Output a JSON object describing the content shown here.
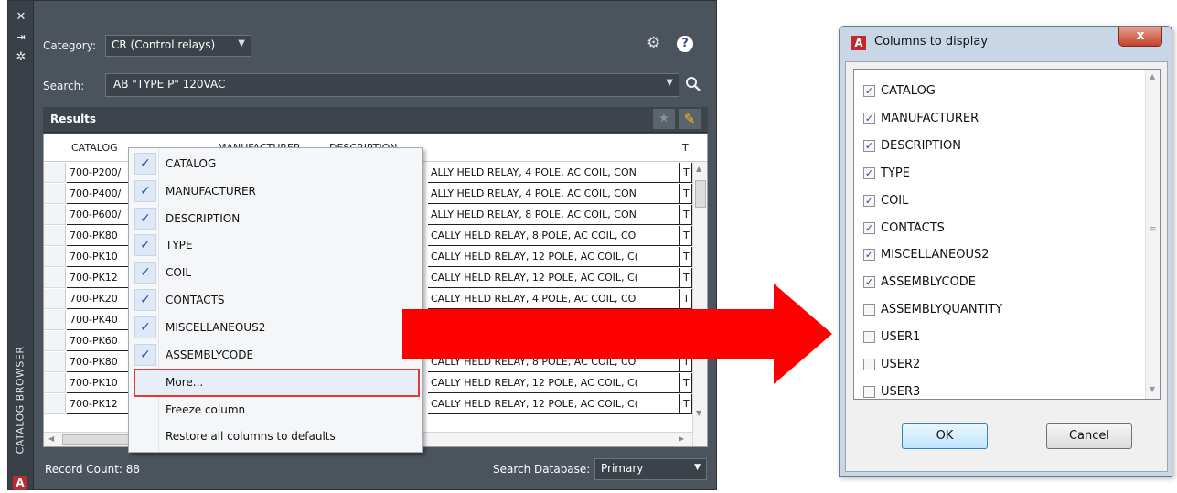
{
  "catalog_browser": {
    "side_title": "CATALOG BROWSER",
    "category_label": "Category:",
    "category_value": "CR (Control relays)",
    "search_label": "Search:",
    "search_value": "AB \"TYPE P\" 120VAC",
    "results_title": "Results",
    "columns": [
      "CATALOG",
      "MANUFACTURER",
      "DESCRIPTION",
      "T"
    ],
    "rows": [
      {
        "catalog": "700-P200/",
        "description": "ALLY HELD RELAY, 4 POLE, AC COIL, CON",
        "type": "T"
      },
      {
        "catalog": "700-P400/",
        "description": "ALLY HELD RELAY, 4 POLE, AC COIL, CON",
        "type": "T"
      },
      {
        "catalog": "700-P600/",
        "description": "ALLY HELD RELAY, 8 POLE, AC COIL, CON",
        "type": "T"
      },
      {
        "catalog": "700-PK80",
        "description": "CALLY HELD RELAY, 8 POLE, AC COIL, CO",
        "type": "T"
      },
      {
        "catalog": "700-PK10",
        "description": "CALLY HELD RELAY, 12 POLE, AC COIL, C(",
        "type": "T"
      },
      {
        "catalog": "700-PK12",
        "description": "CALLY HELD RELAY, 12 POLE, AC COIL, C(",
        "type": "T"
      },
      {
        "catalog": "700-PK20",
        "description": "CALLY HELD RELAY, 4 POLE, AC COIL, CO",
        "type": "T"
      },
      {
        "catalog": "700-PK40",
        "description": "",
        "type": ""
      },
      {
        "catalog": "700-PK60",
        "description": "",
        "type": ""
      },
      {
        "catalog": "700-PK80",
        "description": "CALLY HELD RELAY, 8 POLE, AC COIL, CO",
        "type": "T"
      },
      {
        "catalog": "700-PK10",
        "description": "CALLY HELD RELAY, 12 POLE, AC COIL, C(",
        "type": "T"
      },
      {
        "catalog": "700-PK12",
        "description": "CALLY HELD RELAY, 12 POLE, AC COIL, C(",
        "type": "T"
      }
    ],
    "record_count": "Record Count: 88",
    "search_db_label": "Search Database:",
    "search_db_value": "Primary"
  },
  "context_menu": {
    "checked_items": [
      "CATALOG",
      "MANUFACTURER",
      "DESCRIPTION",
      "TYPE",
      "COIL",
      "CONTACTS",
      "MISCELLANEOUS2",
      "ASSEMBLYCODE"
    ],
    "more": "More...",
    "freeze": "Freeze column",
    "restore": "Restore all columns to defaults"
  },
  "dialog": {
    "title": "Columns to display",
    "close_glyph": "x",
    "items": [
      {
        "label": "CATALOG",
        "checked": true
      },
      {
        "label": "MANUFACTURER",
        "checked": true
      },
      {
        "label": "DESCRIPTION",
        "checked": true
      },
      {
        "label": "TYPE",
        "checked": true
      },
      {
        "label": "COIL",
        "checked": true
      },
      {
        "label": "CONTACTS",
        "checked": true
      },
      {
        "label": "MISCELLANEOUS2",
        "checked": true
      },
      {
        "label": "ASSEMBLYCODE",
        "checked": true
      },
      {
        "label": "ASSEMBLYQUANTITY",
        "checked": false
      },
      {
        "label": "USER1",
        "checked": false
      },
      {
        "label": "USER2",
        "checked": false
      },
      {
        "label": "USER3",
        "checked": false
      }
    ],
    "ok": "OK",
    "cancel": "Cancel"
  },
  "colors": {
    "palette_bg": "#4b535d",
    "highlight_border": "#e23a3a",
    "arrow_red": "#ff0000",
    "check_blue": "#2154b4"
  },
  "icons": [
    "close-icon",
    "pin-icon",
    "settings-icon",
    "gear-icon",
    "help-icon",
    "search-icon",
    "star-icon",
    "pencil-icon",
    "autocad-logo-icon",
    "checkmark-icon",
    "right-arrow-icon"
  ]
}
